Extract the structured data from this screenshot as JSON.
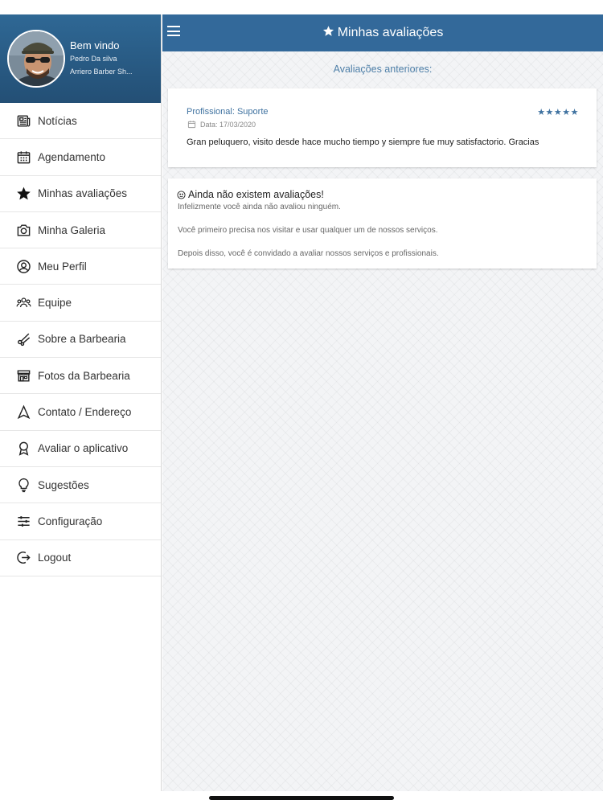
{
  "sidebar": {
    "welcome": "Bem vindo",
    "user_name": "Pedro Da silva",
    "shop_name": "Arriero Barber Sh...",
    "items": [
      {
        "label": "Notícias",
        "icon": "newspaper-icon"
      },
      {
        "label": "Agendamento",
        "icon": "calendar-icon"
      },
      {
        "label": "Minhas avaliações",
        "icon": "star-icon"
      },
      {
        "label": "Minha Galeria",
        "icon": "camera-icon"
      },
      {
        "label": "Meu Perfil",
        "icon": "user-circle-icon"
      },
      {
        "label": "Equipe",
        "icon": "team-icon"
      },
      {
        "label": "Sobre a Barbearia",
        "icon": "scissors-icon"
      },
      {
        "label": "Fotos da Barbearia",
        "icon": "storefront-icon"
      },
      {
        "label": "Contato / Endereço",
        "icon": "navigation-icon"
      },
      {
        "label": "Avaliar o aplicativo",
        "icon": "award-icon"
      },
      {
        "label": "Sugestões",
        "icon": "lightbulb-icon"
      },
      {
        "label": "Configuração",
        "icon": "sliders-icon"
      },
      {
        "label": "Logout",
        "icon": "logout-icon"
      }
    ]
  },
  "header": {
    "title": "Minhas avaliações"
  },
  "main": {
    "section_title": "Avaliações anteriores:",
    "review": {
      "professional": "Profissional: Suporte",
      "date": "Data: 17/03/2020",
      "rating": 5,
      "stars": "★★★★★",
      "comment": "Gran peluquero, visito desde hace mucho tiempo y siempre fue muy satisfactorio. Gracias"
    },
    "empty": {
      "heading": "Ainda não existem avaliações!",
      "line1": "Infelizmente você ainda não avaliou ninguém.",
      "line2": "Você primeiro precisa nos visitar e usar qualquer um de nossos serviços.",
      "line3": "Depois disso, você é convidado a avaliar nossos serviços e profissionais."
    }
  },
  "colors": {
    "primary": "#33699a",
    "accent_text": "#3f72a0",
    "sidebar_header": "#2a5c86"
  }
}
